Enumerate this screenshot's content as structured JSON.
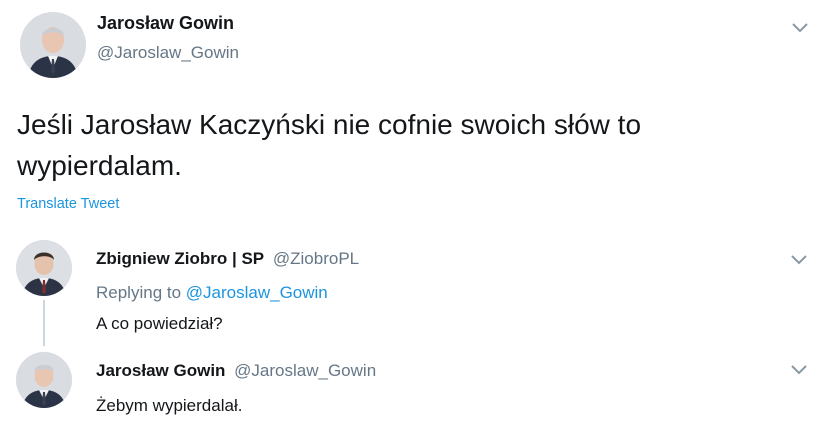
{
  "main_tweet": {
    "author_name": "Jarosław Gowin",
    "author_handle": "@Jaroslaw_Gowin",
    "text": "Jeśli Jarosław Kaczyński nie cofnie swoich słów to wypierdalam.",
    "translate_label": "Translate Tweet"
  },
  "reply_1": {
    "author_name": "Zbigniew Ziobro | SP",
    "author_handle": "@ZiobroPL",
    "replying_prefix": "Replying to ",
    "replying_handle": "@Jaroslaw_Gowin",
    "text": "A co powiedział?"
  },
  "reply_2": {
    "author_name": "Jarosław Gowin",
    "author_handle": "@Jaroslaw_Gowin",
    "text": "Żebym wypierdalał."
  },
  "icons": {
    "menu": "chevron-down-icon",
    "avatar": "avatar-photo"
  },
  "colors": {
    "link": "#1b95e0",
    "handle": "#657786",
    "text": "#14171a",
    "thread_line": "#ccd6dd"
  }
}
